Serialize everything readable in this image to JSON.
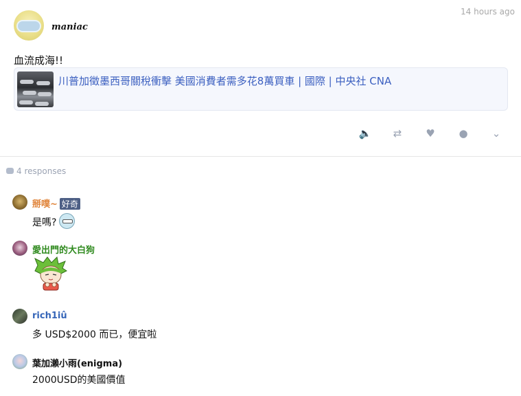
{
  "post": {
    "username": "maniac",
    "timestamp": "14 hours ago",
    "text": "血流成海!!",
    "link": {
      "title": "川普加徵墨西哥關稅衝擊 美國消費者需多花8萬買車 | 國際 | 中央社 CNA"
    },
    "actions": [
      {
        "name": "announce-icon",
        "glyph": "🔈"
      },
      {
        "name": "repost-icon",
        "glyph": "⇄"
      },
      {
        "name": "heart-icon",
        "glyph": "♥"
      },
      {
        "name": "globe-icon",
        "glyph": "●"
      },
      {
        "name": "chevron-down-icon",
        "glyph": "⌄"
      }
    ]
  },
  "responses": {
    "count_label": "4 responses",
    "items": [
      {
        "name": "掰噗~",
        "color": "#e0843a",
        "badge": "好奇",
        "text": "是嗎?"
      },
      {
        "name": "愛出門的大白狗",
        "color": "#2f8a1e",
        "badge": "",
        "text": ""
      },
      {
        "name": "rich1iû",
        "color": "#3565b8",
        "badge": "",
        "text": "多 USD$2000 而已，便宜啦"
      },
      {
        "name": "葉加瀨小雨(enigma)",
        "color": "#111111",
        "badge": "",
        "text": "2000USD的美國價值"
      }
    ]
  },
  "colors": {
    "link": "#3b5fc0",
    "muted": "#a8a8a8",
    "card_bg": "#f5f7fd",
    "badge_bg": "#4d5f85"
  }
}
